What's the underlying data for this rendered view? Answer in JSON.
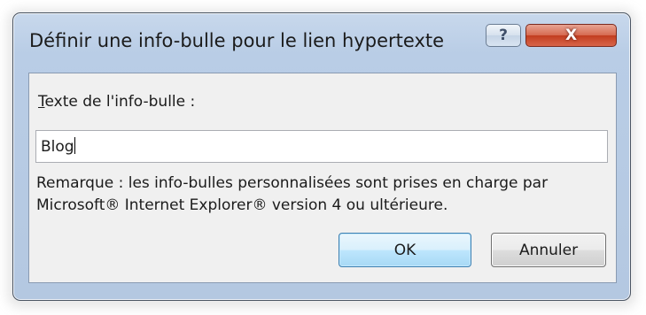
{
  "dialog": {
    "title": "Définir une info-bulle pour le lien hypertexte",
    "help_glyph": "?",
    "close_glyph": "X"
  },
  "form": {
    "label_accesskey": "T",
    "label_rest": "exte de l'info-bulle :",
    "input_value": "Blog",
    "note": "Remarque : les info-bulles personnalisées sont prises en charge par Microsoft® Internet Explorer® version 4 ou ultérieure."
  },
  "buttons": {
    "ok": "OK",
    "cancel": "Annuler"
  },
  "icons": {
    "help": "help-icon",
    "close": "close-icon"
  },
  "colors": {
    "close_button": "#c23d1f",
    "default_button_border": "#3c7fb1",
    "frame": "#b9cde6"
  }
}
